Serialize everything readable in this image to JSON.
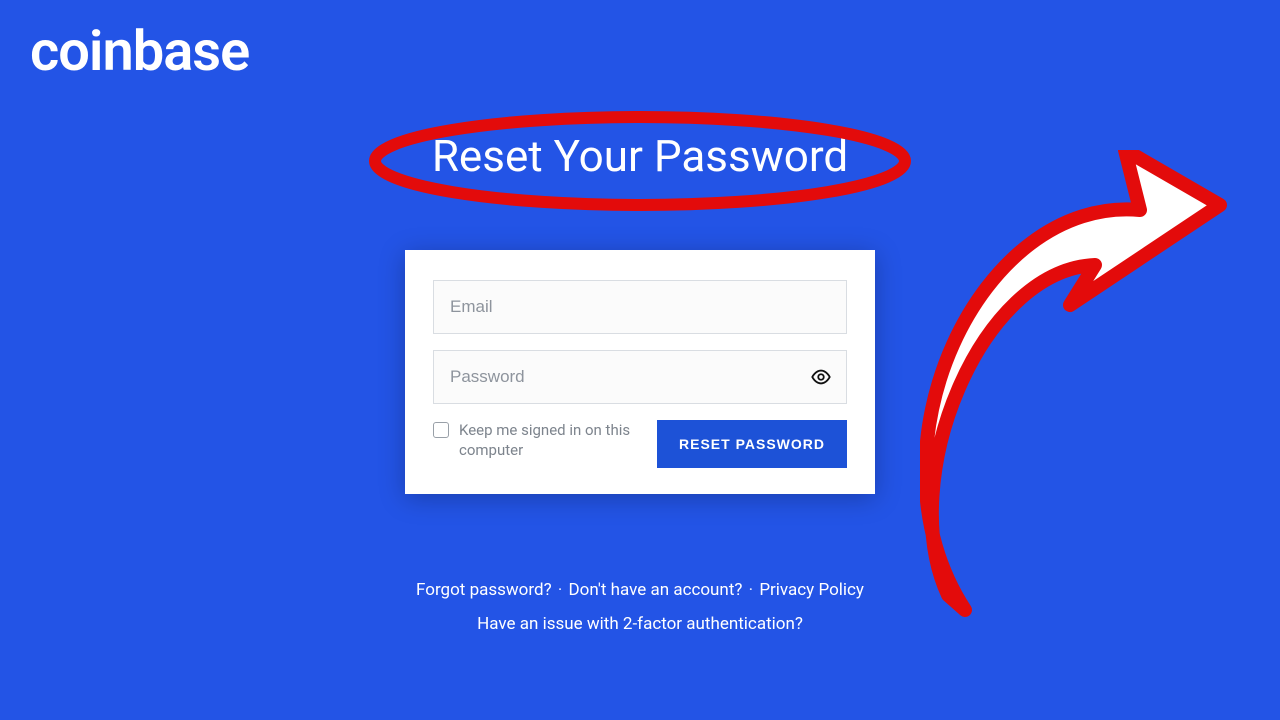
{
  "brand": "coinbase",
  "title": "Reset Your Password",
  "form": {
    "email_placeholder": "Email",
    "password_placeholder": "Password",
    "keep_signed_label": "Keep me signed in on this computer",
    "submit_label": "RESET PASSWORD"
  },
  "links": {
    "forgot": "Forgot password?",
    "no_account": "Don't have an account?",
    "privacy": "Privacy Policy",
    "two_factor": "Have an issue with 2-factor authentication?"
  },
  "colors": {
    "bg": "#2354e6",
    "accent": "#1d52d7",
    "annotation": "#e30b0b"
  }
}
